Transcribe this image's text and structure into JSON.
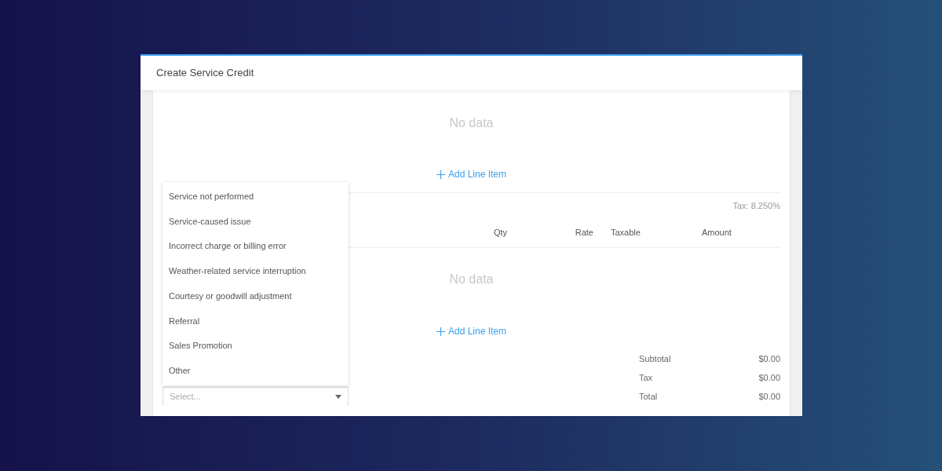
{
  "dialog": {
    "title": "Create Service Credit"
  },
  "first_table": {
    "empty_text": "No data",
    "add_button": {
      "label": "Add Line Item"
    }
  },
  "second_table": {
    "tax_rate": "Tax: 8.250%",
    "columns": [
      {
        "label": "Qty"
      },
      {
        "label": "Rate"
      },
      {
        "label": "Taxable"
      },
      {
        "label": "Amount"
      }
    ],
    "empty_text": "No data",
    "add_button": {
      "label": "Add Line Item"
    }
  },
  "reason_select": {
    "placeholder": "Select...",
    "expanded": true,
    "options": [
      {
        "label": "Service not performed"
      },
      {
        "label": "Service-caused issue"
      },
      {
        "label": "Incorrect charge or billing error"
      },
      {
        "label": "Weather-related service interruption"
      },
      {
        "label": "Courtesy or goodwill adjustment"
      },
      {
        "label": "Referral"
      },
      {
        "label": "Sales Promotion"
      },
      {
        "label": "Other"
      }
    ]
  },
  "totals": [
    {
      "label": "Subtotal",
      "value": "$0.00"
    },
    {
      "label": "Tax",
      "value": "$0.00"
    },
    {
      "label": "Total",
      "value": "$0.00"
    }
  ]
}
